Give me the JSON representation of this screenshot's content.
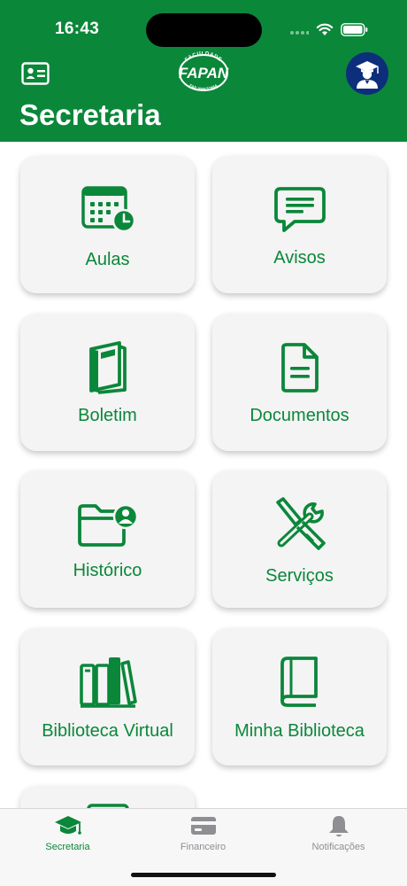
{
  "status_bar": {
    "time": "16:43"
  },
  "header": {
    "title": "Secretaria",
    "logo_text": "FAPAN",
    "logo_arc_top": "FACULDADE",
    "logo_arc_bottom": "FAP AMAZONIA",
    "brand_color": "#0b873a",
    "avatar_color": "#0d2e7a"
  },
  "menu": {
    "items": [
      {
        "label": "Aulas",
        "icon": "calendar-clock-icon"
      },
      {
        "label": "Avisos",
        "icon": "message-icon"
      },
      {
        "label": "Boletim",
        "icon": "report-book-icon"
      },
      {
        "label": "Documentos",
        "icon": "document-icon"
      },
      {
        "label": "Histórico",
        "icon": "folder-user-icon"
      },
      {
        "label": "Serviços",
        "icon": "tools-icon"
      },
      {
        "label": "Biblioteca Virtual",
        "icon": "books-icon"
      },
      {
        "label": "Minha Biblioteca",
        "icon": "book-icon"
      }
    ]
  },
  "tabbar": {
    "tabs": [
      {
        "label": "Secretaria",
        "icon": "graduation-cap-icon",
        "active": true
      },
      {
        "label": "Financeiro",
        "icon": "credit-card-icon",
        "active": false
      },
      {
        "label": "Notificações",
        "icon": "bell-icon",
        "active": false
      }
    ],
    "active_color": "#0b873a",
    "inactive_color": "#8e8e93"
  }
}
